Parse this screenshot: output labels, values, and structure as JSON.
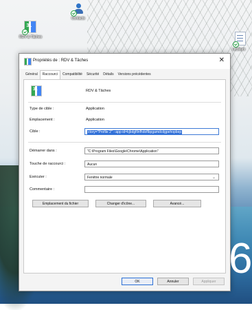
{
  "desktop": {
    "icons": [
      {
        "name": "rdv-taches-shortcut",
        "label": "RDV & Tâches",
        "number": "31"
      },
      {
        "name": "contacts-shortcut",
        "label": "Contacts"
      },
      {
        "name": "document-shortcut",
        "label": "Lecteurs"
      }
    ],
    "corner_number": "6"
  },
  "dialog": {
    "title": "Propriétés de : RDV & Tâches",
    "close": "✕",
    "tabs": [
      "Général",
      "Raccourci",
      "Compatibilité",
      "Sécurité",
      "Détails",
      "Versions précédentes"
    ],
    "active_tab": "Raccourci",
    "icon_number": "31",
    "app_name": "RDV & Tâches",
    "labels": {
      "target_type": "Type de cible :",
      "location": "Emplacement :",
      "target": "Cible :",
      "start_in": "Démarrer dans :",
      "shortcut_key": "Touche de raccourci :",
      "run": "Exécuter :",
      "comment": "Commentaire :"
    },
    "values": {
      "target_type": "Application",
      "location": "Application",
      "target": "ctory=\"Profile 2\" --app-id=kjbdgfilnfhdoflbpgamdcdgpehopbep",
      "start_in": "\"C:\\Program Files\\Google\\Chrome\\Application\"",
      "shortcut_key": "Aucun",
      "run": "Fenêtre normale",
      "comment": ""
    },
    "buttons": {
      "open_location": "Emplacement du fichier",
      "change_icon": "Changer d'icône...",
      "advanced": "Avancé...",
      "ok": "OK",
      "cancel": "Annuler",
      "apply": "Appliquer"
    }
  }
}
